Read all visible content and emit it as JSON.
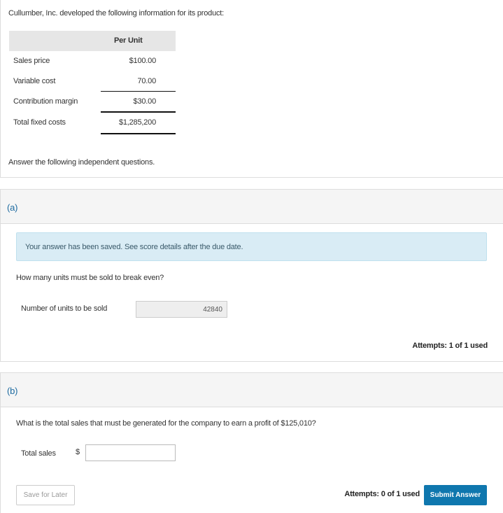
{
  "intro": {
    "text": "Cullumber, Inc. developed the following information for its product:",
    "table": {
      "header": "Per Unit",
      "rows": [
        {
          "label": "Sales price",
          "value": "$100.00"
        },
        {
          "label": "Variable cost",
          "value": "70.00"
        },
        {
          "label": "Contribution margin",
          "value": "$30.00"
        },
        {
          "label": "Total fixed costs",
          "value": "$1,285,200"
        }
      ]
    },
    "instruction": "Answer the following independent questions."
  },
  "part_a": {
    "label": "(a)",
    "notice": "Your answer has been saved. See score details after the due date.",
    "question": "How many units must be sold to break even?",
    "field_label": "Number of units to be sold",
    "field_value": "42840",
    "attempts": "Attempts: 1 of 1 used"
  },
  "part_b": {
    "label": "(b)",
    "question": "What is the total sales that must be generated for the company to earn a profit of $125,010?",
    "field_label": "Total sales",
    "currency": "$",
    "field_value": "",
    "save_label": "Save for Later",
    "attempts": "Attempts: 0 of 1 used",
    "submit_label": "Submit Answer"
  },
  "colors": {
    "accent": "#0f77ae",
    "notice_bg": "#d9ecf5",
    "part_label": "#1c6aa0"
  }
}
